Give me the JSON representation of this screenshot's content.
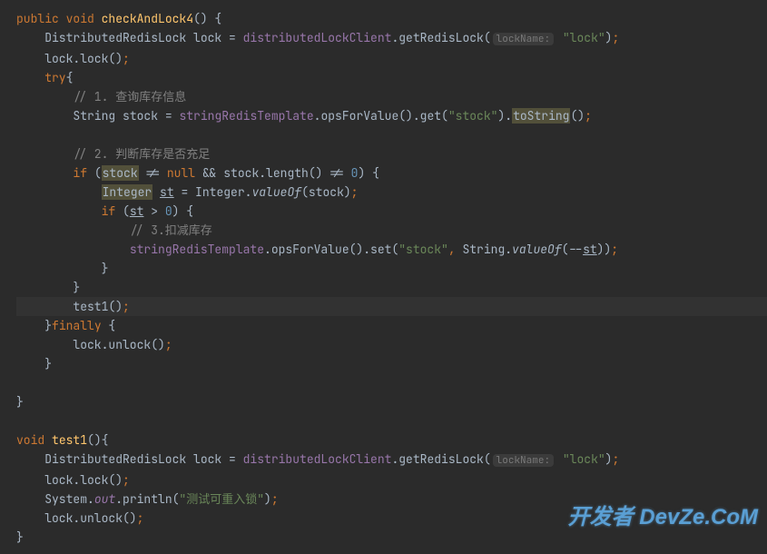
{
  "lines": {
    "l1_public": "public",
    "l1_void": " void",
    "l1_method": " checkAndLock4",
    "l1_rest": "() {",
    "l2_type": "    DistributedRedisLock ",
    "l2_var": "lock",
    "l2_eq": " = ",
    "l2_field": "distributedLockClient",
    "l2_dot": ".",
    "l2_call": "getRedisLock(",
    "l2_hint": "lockName:",
    "l2_str": " \"lock\"",
    "l2_end": ")",
    "l2_semi": ";",
    "l3": "    lock.lock()",
    "l3_semi": ";",
    "l4_try": "    try",
    "l4_brace": "{",
    "l5_comment": "        // 1. 查询库存信息",
    "l6_pre": "        String ",
    "l6_var": "stock",
    "l6_eq": " = ",
    "l6_field": "stringRedisTemplate",
    "l6_call": ".opsForValue().get(",
    "l6_str": "\"stock\"",
    "l6_close": ").",
    "l6_tostr": "toString",
    "l6_end": "()",
    "l6_semi": ";",
    "l8_comment": "        // 2. 判断库存是否充足",
    "l9_if": "        if",
    "l9_open": " (",
    "l9_stock": "stock",
    "l9_neq": " != ",
    "l9_null": "null",
    "l9_and": " && stock.length() != ",
    "l9_zero": "0",
    "l9_end": ") {",
    "l10_pre": "            ",
    "l10_int": "Integer",
    "l10_sp": " ",
    "l10_st": "st",
    "l10_eq": " = Integer.",
    "l10_valueof": "valueOf",
    "l10_end": "(stock)",
    "l10_semi": ";",
    "l11_if": "            if",
    "l11_open": " (",
    "l11_st": "st",
    "l11_gt": " > ",
    "l11_zero": "0",
    "l11_end": ") {",
    "l12_comment": "                // 3.扣减库存",
    "l13_pre": "                ",
    "l13_field": "stringRedisTemplate",
    "l13_call": ".opsForValue().set(",
    "l13_str": "\"stock\"",
    "l13_comma": ",",
    "l13_sp": " String.",
    "l13_valueof": "valueOf",
    "l13_open": "(--",
    "l13_st": "st",
    "l13_end": "))",
    "l13_semi": ";",
    "l14": "            }",
    "l15": "        }",
    "l16": "        test1()",
    "l16_semi": ";",
    "l17_close": "    }",
    "l17_finally": "finally",
    "l17_brace": " {",
    "l18": "        lock.unlock()",
    "l18_semi": ";",
    "l19": "    }",
    "l21": "}",
    "m1_void": "void",
    "m1_sp": " ",
    "m1_name": "test1",
    "m1_end": "(){",
    "m2_type": "    DistributedRedisLock ",
    "m2_var": "lock",
    "m2_eq": " = ",
    "m2_field": "distributedLockClient",
    "m2_dot": ".",
    "m2_call": "getRedisLock(",
    "m2_hint": "lockName:",
    "m2_str": " \"lock\"",
    "m2_end": ")",
    "m2_semi": ";",
    "m3": "    lock.lock()",
    "m3_semi": ";",
    "m4_pre": "    System.",
    "m4_out": "out",
    "m4_call": ".println(",
    "m4_str": "\"测试可重入锁\"",
    "m4_end": ")",
    "m4_semi": ";",
    "m5": "    lock.unlock()",
    "m5_semi": ";",
    "m6": "}"
  },
  "watermark": "开发者 DevZe.CoM"
}
